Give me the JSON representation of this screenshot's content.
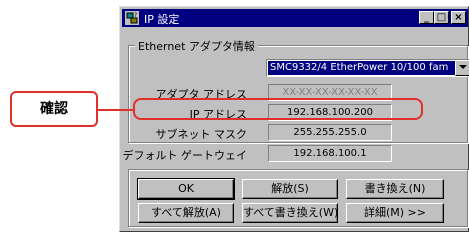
{
  "window": {
    "title": "IP 設定",
    "controls": {
      "minimize": "_",
      "maximize": "□",
      "close": "×"
    }
  },
  "group": {
    "label": "Ethernet アダプタ情報",
    "adapter_select": {
      "value": "SMC9332/4 EtherPower 10/100 fam"
    }
  },
  "fields": [
    {
      "label": "アダプタ アドレス",
      "value": "XX-XX-XX-XX-XX-XX"
    },
    {
      "label": "IP アドレス",
      "value": "192.168.100.200"
    },
    {
      "label": "サブネット マスク",
      "value": "255.255.255.0"
    },
    {
      "label": "デフォルト ゲートウェイ",
      "value": "192.168.100.1"
    }
  ],
  "buttons": {
    "ok": "OK",
    "release": "解放(S)",
    "renew": "書き換え(N)",
    "release_all": "すべて解放(A)",
    "renew_all": "すべて書き換え(W)",
    "details": "詳細(M) >>"
  },
  "annotation": {
    "callout": "確認",
    "color": "#e1302a"
  },
  "colors": {
    "titlebar": "#000080",
    "face": "#c0c0c0"
  }
}
